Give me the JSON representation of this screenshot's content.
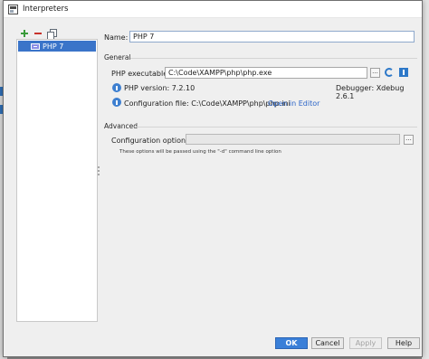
{
  "window": {
    "title": "Interpreters"
  },
  "toolbar": {
    "add_icon": "plus-icon",
    "remove_icon": "minus-icon",
    "copy_icon": "copy-icon"
  },
  "interpreters": [
    {
      "label": "PHP 7"
    }
  ],
  "form": {
    "name_label": "Name:",
    "name_value": "PHP 7",
    "general_label": "General",
    "executable_label": "PHP executable:",
    "executable_value": "C:\\Code\\XAMPP\\php\\php.exe",
    "browse_label": "...",
    "version_label": "PHP version: 7.2.10",
    "debugger_label": "Debugger: Xdebug 2.6.1",
    "config_file_label": "Configuration file: C:\\Code\\XAMPP\\php\\php.ini",
    "open_in_editor": "Open in Editor",
    "advanced_label": "Advanced",
    "config_options_label": "Configuration options:",
    "config_options_value": "",
    "config_options_hint": "These options will be passed using the \"-d\" command line option"
  },
  "buttons": {
    "ok": "OK",
    "cancel": "Cancel",
    "apply": "Apply",
    "help": "Help"
  },
  "colors": {
    "accent": "#3a7fd8",
    "selection": "#3a74c9",
    "link": "#2d66c8",
    "add": "#3a9b3a",
    "remove": "#c8322b"
  }
}
